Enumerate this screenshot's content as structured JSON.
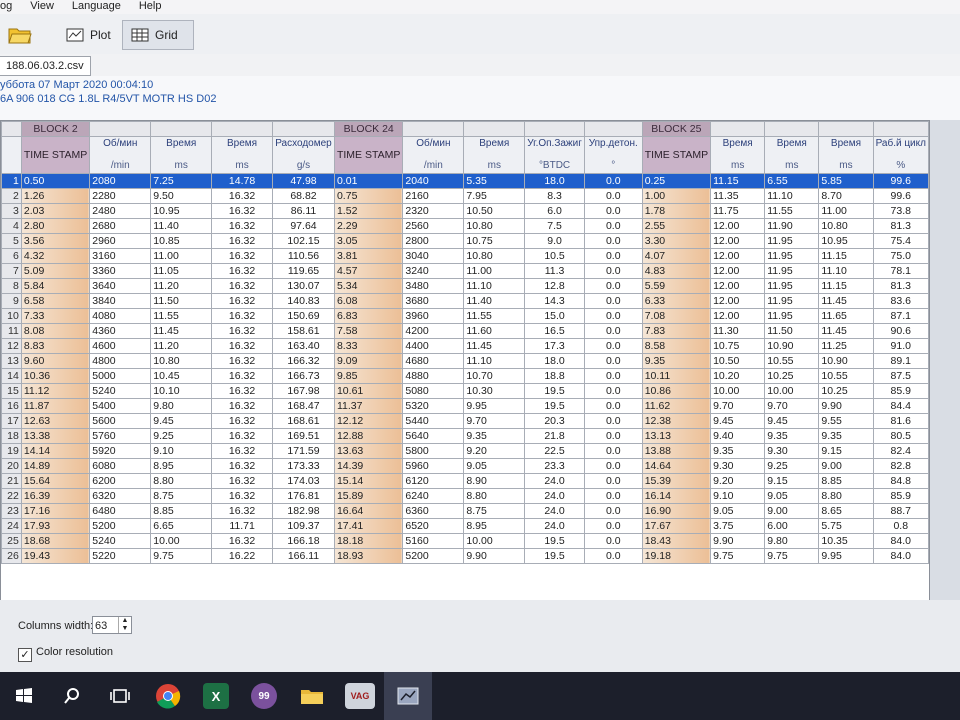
{
  "menubar": {
    "items": [
      "og",
      "View",
      "Language",
      "Help"
    ]
  },
  "toolbar": {
    "plot_label": "Plot",
    "grid_label": "Grid"
  },
  "file_tab": {
    "label": "188.06.03.2.csv"
  },
  "info": {
    "date_line": "уббота 07 Март 2020 00:04:10",
    "ecu_line": "6A 906 018 CG  1.8L R4/5VT MOTR HS D02"
  },
  "grid": {
    "blocks": [
      {
        "label": "BLOCK 2",
        "span": 5
      },
      {
        "label": "BLOCK 24",
        "span": 5
      },
      {
        "label": "BLOCK 25",
        "span": 5
      }
    ],
    "headers": [
      {
        "name": "TIME STAMP",
        "unit": "",
        "ts": true
      },
      {
        "name": "Об/мин",
        "unit": "/min"
      },
      {
        "name": "Время",
        "unit": "ms"
      },
      {
        "name": "Время",
        "unit": "ms"
      },
      {
        "name": "Расходомер",
        "unit": "g/s"
      },
      {
        "name": "TIME STAMP",
        "unit": "",
        "ts": true
      },
      {
        "name": "Об/мин",
        "unit": "/min"
      },
      {
        "name": "Время",
        "unit": "ms"
      },
      {
        "name": "Уг.Оп.Зажиг",
        "unit": "°BTDC"
      },
      {
        "name": "Упр.детон.",
        "unit": "°"
      },
      {
        "name": "TIME STAMP",
        "unit": "",
        "ts": true
      },
      {
        "name": "Время",
        "unit": "ms"
      },
      {
        "name": "Время",
        "unit": "ms"
      },
      {
        "name": "Время",
        "unit": "ms"
      },
      {
        "name": "Раб.й цикл",
        "unit": "%"
      }
    ],
    "rows": [
      [
        "0.50",
        "2080",
        "7.25",
        "14.78",
        "47.98",
        "0.01",
        "2040",
        "5.35",
        "18.0",
        "0.0",
        "0.25",
        "11.15",
        "6.55",
        "5.85",
        "99.6"
      ],
      [
        "1.26",
        "2280",
        "9.50",
        "16.32",
        "68.82",
        "0.75",
        "2160",
        "7.95",
        "8.3",
        "0.0",
        "1.00",
        "11.35",
        "11.10",
        "8.70",
        "99.6"
      ],
      [
        "2.03",
        "2480",
        "10.95",
        "16.32",
        "86.11",
        "1.52",
        "2320",
        "10.50",
        "6.0",
        "0.0",
        "1.78",
        "11.75",
        "11.55",
        "11.00",
        "73.8"
      ],
      [
        "2.80",
        "2680",
        "11.40",
        "16.32",
        "97.64",
        "2.29",
        "2560",
        "10.80",
        "7.5",
        "0.0",
        "2.55",
        "12.00",
        "11.90",
        "10.80",
        "81.3"
      ],
      [
        "3.56",
        "2960",
        "10.85",
        "16.32",
        "102.15",
        "3.05",
        "2800",
        "10.75",
        "9.0",
        "0.0",
        "3.30",
        "12.00",
        "11.95",
        "10.95",
        "75.4"
      ],
      [
        "4.32",
        "3160",
        "11.00",
        "16.32",
        "110.56",
        "3.81",
        "3040",
        "10.80",
        "10.5",
        "0.0",
        "4.07",
        "12.00",
        "11.95",
        "11.15",
        "75.0"
      ],
      [
        "5.09",
        "3360",
        "11.05",
        "16.32",
        "119.65",
        "4.57",
        "3240",
        "11.00",
        "11.3",
        "0.0",
        "4.83",
        "12.00",
        "11.95",
        "11.10",
        "78.1"
      ],
      [
        "5.84",
        "3640",
        "11.20",
        "16.32",
        "130.07",
        "5.34",
        "3480",
        "11.10",
        "12.8",
        "0.0",
        "5.59",
        "12.00",
        "11.95",
        "11.15",
        "81.3"
      ],
      [
        "6.58",
        "3840",
        "11.50",
        "16.32",
        "140.83",
        "6.08",
        "3680",
        "11.40",
        "14.3",
        "0.0",
        "6.33",
        "12.00",
        "11.95",
        "11.45",
        "83.6"
      ],
      [
        "7.33",
        "4080",
        "11.55",
        "16.32",
        "150.69",
        "6.83",
        "3960",
        "11.55",
        "15.0",
        "0.0",
        "7.08",
        "12.00",
        "11.95",
        "11.65",
        "87.1"
      ],
      [
        "8.08",
        "4360",
        "11.45",
        "16.32",
        "158.61",
        "7.58",
        "4200",
        "11.60",
        "16.5",
        "0.0",
        "7.83",
        "11.30",
        "11.50",
        "11.45",
        "90.6"
      ],
      [
        "8.83",
        "4600",
        "11.20",
        "16.32",
        "163.40",
        "8.33",
        "4400",
        "11.45",
        "17.3",
        "0.0",
        "8.58",
        "10.75",
        "10.90",
        "11.25",
        "91.0"
      ],
      [
        "9.60",
        "4800",
        "10.80",
        "16.32",
        "166.32",
        "9.09",
        "4680",
        "11.10",
        "18.0",
        "0.0",
        "9.35",
        "10.50",
        "10.55",
        "10.90",
        "89.1"
      ],
      [
        "10.36",
        "5000",
        "10.45",
        "16.32",
        "166.73",
        "9.85",
        "4880",
        "10.70",
        "18.8",
        "0.0",
        "10.11",
        "10.20",
        "10.25",
        "10.55",
        "87.5"
      ],
      [
        "11.12",
        "5240",
        "10.10",
        "16.32",
        "167.98",
        "10.61",
        "5080",
        "10.30",
        "19.5",
        "0.0",
        "10.86",
        "10.00",
        "10.00",
        "10.25",
        "85.9"
      ],
      [
        "11.87",
        "5400",
        "9.80",
        "16.32",
        "168.47",
        "11.37",
        "5320",
        "9.95",
        "19.5",
        "0.0",
        "11.62",
        "9.70",
        "9.70",
        "9.90",
        "84.4"
      ],
      [
        "12.63",
        "5600",
        "9.45",
        "16.32",
        "168.61",
        "12.12",
        "5440",
        "9.70",
        "20.3",
        "0.0",
        "12.38",
        "9.45",
        "9.45",
        "9.55",
        "81.6"
      ],
      [
        "13.38",
        "5760",
        "9.25",
        "16.32",
        "169.51",
        "12.88",
        "5640",
        "9.35",
        "21.8",
        "0.0",
        "13.13",
        "9.40",
        "9.35",
        "9.35",
        "80.5"
      ],
      [
        "14.14",
        "5920",
        "9.10",
        "16.32",
        "171.59",
        "13.63",
        "5800",
        "9.20",
        "22.5",
        "0.0",
        "13.88",
        "9.35",
        "9.30",
        "9.15",
        "82.4"
      ],
      [
        "14.89",
        "6080",
        "8.95",
        "16.32",
        "173.33",
        "14.39",
        "5960",
        "9.05",
        "23.3",
        "0.0",
        "14.64",
        "9.30",
        "9.25",
        "9.00",
        "82.8"
      ],
      [
        "15.64",
        "6200",
        "8.80",
        "16.32",
        "174.03",
        "15.14",
        "6120",
        "8.90",
        "24.0",
        "0.0",
        "15.39",
        "9.20",
        "9.15",
        "8.85",
        "84.8"
      ],
      [
        "16.39",
        "6320",
        "8.75",
        "16.32",
        "176.81",
        "15.89",
        "6240",
        "8.80",
        "24.0",
        "0.0",
        "16.14",
        "9.10",
        "9.05",
        "8.80",
        "85.9"
      ],
      [
        "17.16",
        "6480",
        "8.85",
        "16.32",
        "182.98",
        "16.64",
        "6360",
        "8.75",
        "24.0",
        "0.0",
        "16.90",
        "9.05",
        "9.00",
        "8.65",
        "88.7"
      ],
      [
        "17.93",
        "5200",
        "6.65",
        "11.71",
        "109.37",
        "17.41",
        "6520",
        "8.95",
        "24.0",
        "0.0",
        "17.67",
        "3.75",
        "6.00",
        "5.75",
        "0.8"
      ],
      [
        "18.68",
        "5240",
        "10.00",
        "16.32",
        "166.18",
        "18.18",
        "5160",
        "10.00",
        "19.5",
        "0.0",
        "18.43",
        "9.90",
        "9.80",
        "10.35",
        "84.0"
      ],
      [
        "19.43",
        "5220",
        "9.75",
        "16.22",
        "166.11",
        "18.93",
        "5200",
        "9.90",
        "19.5",
        "0.0",
        "19.18",
        "9.75",
        "9.75",
        "9.95",
        "84.0"
      ]
    ]
  },
  "bottom": {
    "columns_width_label": "Columns width:",
    "columns_width_value": "63",
    "color_resolution_label": "Color resolution",
    "color_resolution_checked": true
  },
  "taskbar": {
    "icons": [
      "windows-start-icon",
      "search-icon",
      "task-view-icon",
      "chrome-icon",
      "excel-icon",
      "viber-icon",
      "explorer-icon",
      "vag-app-icon",
      "vcds-icon"
    ],
    "viber_badge": "99",
    "excel_letter": "X"
  },
  "colors": {
    "selection": "#1f5fcc",
    "block_header": "#bba6b8",
    "timestamp_fill": "#ecbf96"
  }
}
